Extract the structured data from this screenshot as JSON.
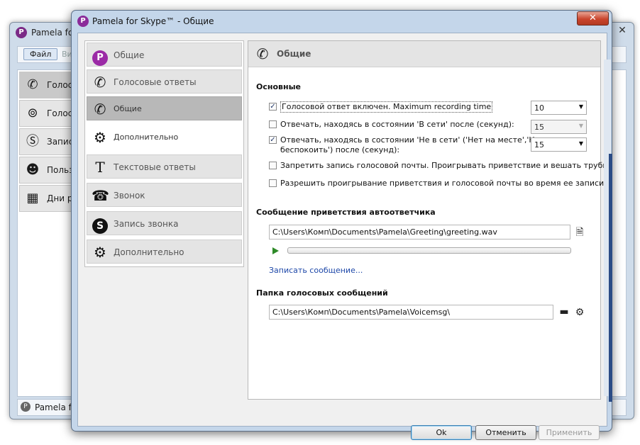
{
  "background_window": {
    "title": "Pamela for",
    "menu": {
      "file": "Файл",
      "view": "Ви"
    },
    "nav_items": [
      {
        "label": "Голос",
        "icon": "phone-icon"
      },
      {
        "label": "Голос",
        "icon": "voicemail-icon"
      },
      {
        "label": "Запис",
        "icon": "skype-record-icon"
      },
      {
        "label": "Польз",
        "icon": "contacts-icon"
      },
      {
        "label": "Дни ро",
        "icon": "calendar-icon"
      }
    ],
    "status": "Pamela for"
  },
  "dialog": {
    "title": "Pamela for Skype™ - Общие",
    "close_glyph": "✕"
  },
  "nav": [
    {
      "label": "Общие",
      "icon": "pamela-logo-icon",
      "selected": false
    },
    {
      "label": "Голосовые ответы",
      "icon": "phone-icon",
      "selected": false
    },
    {
      "label": "Общие",
      "icon": "phone-icon",
      "selected": true,
      "sub": true
    },
    {
      "label": "Дополнительно",
      "icon": "gear-icon",
      "selected": false,
      "sub": true
    },
    {
      "label": "Текстовые ответы",
      "icon": "text-icon",
      "selected": false
    },
    {
      "label": "Звонок",
      "icon": "phone-handset-icon",
      "selected": false
    },
    {
      "label": "Запись звонка",
      "icon": "skype-icon",
      "selected": false
    },
    {
      "label": "Дополнительно",
      "icon": "gear-icon",
      "selected": false
    }
  ],
  "panel": {
    "title": "Общие",
    "section_main": "Основные",
    "options": [
      {
        "label": "Голосовой ответ включен. Maximum recording time",
        "checked": true,
        "combo": "10",
        "combo_disabled": false
      },
      {
        "label": "Отвечать, находясь в состоянии 'В сети' после (секунд):",
        "checked": false,
        "combo": "15",
        "combo_disabled": true
      },
      {
        "label": "Отвечать, находясь в состоянии 'Не в сети' ('Нет на месте','Не",
        "label2": "беспокоить') после (секунд):",
        "checked": true,
        "combo": "15",
        "combo_disabled": false
      },
      {
        "label": "Запретить запись голосовой почты. Проигрывать приветствие и вешать трубку",
        "checked": false
      },
      {
        "label": "Разрешить проигрывание приветствия и голосовой почты во время ее записи",
        "checked": false
      }
    ],
    "section_greeting": "Сообщение приветствия автоответчика",
    "greeting_path": "C:\\Users\\Комп\\Documents\\Pamela\\Greeting\\greeting.wav",
    "playback_progress": 0,
    "record_link": "Записать сообщение...",
    "section_folder": "Папка голосовых сообщений",
    "folder_path": "C:\\Users\\Комп\\Documents\\Pamela\\Voicemsg\\"
  },
  "buttons": {
    "ok": "Ok",
    "cancel": "Отменить",
    "apply": "Применить"
  },
  "colors": {
    "accent_purple": "#9b2aa6",
    "link": "#1d47a8",
    "close_red": "#c9452d",
    "play_green": "#2e8a28"
  }
}
